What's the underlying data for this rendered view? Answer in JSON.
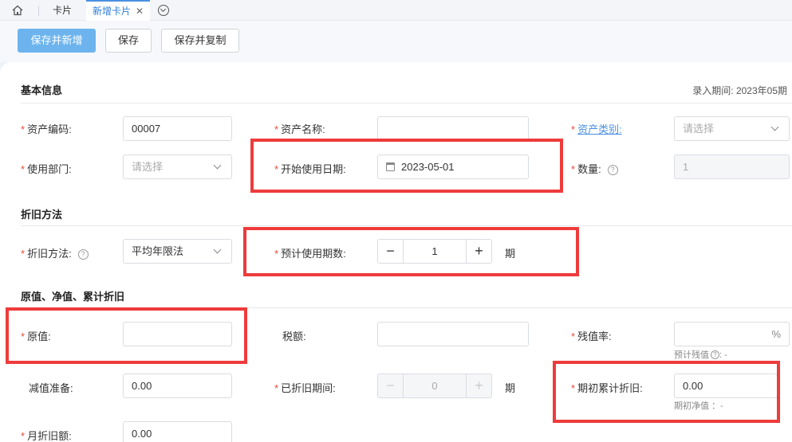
{
  "tabs": {
    "card": "卡片",
    "new_card": "新增卡片",
    "close": "✕"
  },
  "toolbar": {
    "save_and_new": "保存并新增",
    "save": "保存",
    "save_and_copy": "保存并复制"
  },
  "sections": {
    "basic": "基本信息",
    "depreciation": "折旧方法",
    "value": "原值、净值、累计折旧"
  },
  "entry_period": "录入期间: 2023年05期",
  "fields": {
    "asset_code": {
      "label": "资产编码:",
      "value": "00007"
    },
    "asset_name": {
      "label": "资产名称:",
      "value": ""
    },
    "asset_category": {
      "label": "资产类别:",
      "placeholder": "请选择"
    },
    "department": {
      "label": "使用部门:",
      "placeholder": "请选择"
    },
    "start_date": {
      "label": "开始使用日期:",
      "value": "2023-05-01"
    },
    "quantity": {
      "label": "数量:",
      "value": "1"
    },
    "dep_method": {
      "label": "折旧方法:",
      "value": "平均年限法"
    },
    "expected_periods": {
      "label": "预计使用期数:",
      "value": "1",
      "unit": "期"
    },
    "original_value": {
      "label": "原值:",
      "value": ""
    },
    "tax": {
      "label": "税额:",
      "value": ""
    },
    "residual_rate": {
      "label": "残值率:",
      "value": "",
      "unit": "%",
      "hint": "预计残值",
      "hint_value": ": -"
    },
    "impairment": {
      "label": "减值准备:",
      "value": "0.00"
    },
    "depreciated_periods": {
      "label": "已折旧期间:",
      "value": "0",
      "unit": "期"
    },
    "opening_accum_dep": {
      "label": "期初累计折旧:",
      "value": "0.00",
      "hint": "期初净值 ：-"
    },
    "monthly_dep": {
      "label": "月折旧额:",
      "value": "0.00"
    }
  },
  "colors": {
    "accent": "#4a90e2",
    "primary_button": "#6db4ee",
    "required": "#e8483c",
    "highlight": "#ee3b3b"
  }
}
